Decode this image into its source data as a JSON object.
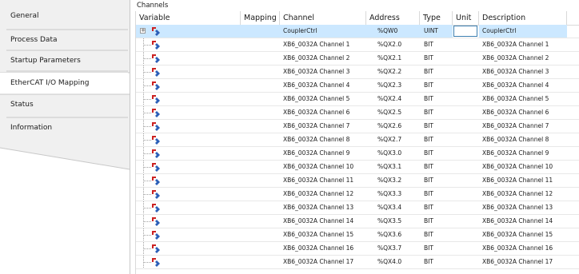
{
  "tabs": [
    {
      "label": "General",
      "active": false
    },
    {
      "label": "Process Data",
      "active": false
    },
    {
      "label": "Startup Parameters",
      "active": false
    },
    {
      "label": "EtherCAT I/O Mapping",
      "active": true
    },
    {
      "label": "Status",
      "active": false
    },
    {
      "label": "Information",
      "active": false
    }
  ],
  "panel": {
    "title": "Channels",
    "columns": [
      "Variable",
      "Mapping",
      "Channel",
      "Address",
      "Type",
      "Unit",
      "Description"
    ],
    "rows": [
      {
        "channel": "CouplerCtrl",
        "address": "%QW0",
        "type": "UINT",
        "description": "CouplerCtrl",
        "selected": true,
        "expandable": true
      },
      {
        "channel": "XB6_0032A Channel 1",
        "address": "%QX2.0",
        "type": "BIT",
        "description": "XB6_0032A Channel 1"
      },
      {
        "channel": "XB6_0032A Channel 2",
        "address": "%QX2.1",
        "type": "BIT",
        "description": "XB6_0032A Channel 2"
      },
      {
        "channel": "XB6_0032A Channel 3",
        "address": "%QX2.2",
        "type": "BIT",
        "description": "XB6_0032A Channel 3"
      },
      {
        "channel": "XB6_0032A Channel 4",
        "address": "%QX2.3",
        "type": "BIT",
        "description": "XB6_0032A Channel 4"
      },
      {
        "channel": "XB6_0032A Channel 5",
        "address": "%QX2.4",
        "type": "BIT",
        "description": "XB6_0032A Channel 5"
      },
      {
        "channel": "XB6_0032A Channel 6",
        "address": "%QX2.5",
        "type": "BIT",
        "description": "XB6_0032A Channel 6"
      },
      {
        "channel": "XB6_0032A Channel 7",
        "address": "%QX2.6",
        "type": "BIT",
        "description": "XB6_0032A Channel 7"
      },
      {
        "channel": "XB6_0032A Channel 8",
        "address": "%QX2.7",
        "type": "BIT",
        "description": "XB6_0032A Channel 8"
      },
      {
        "channel": "XB6_0032A Channel 9",
        "address": "%QX3.0",
        "type": "BIT",
        "description": "XB6_0032A Channel 9"
      },
      {
        "channel": "XB6_0032A Channel 10",
        "address": "%QX3.1",
        "type": "BIT",
        "description": "XB6_0032A Channel 10"
      },
      {
        "channel": "XB6_0032A Channel 11",
        "address": "%QX3.2",
        "type": "BIT",
        "description": "XB6_0032A Channel 11"
      },
      {
        "channel": "XB6_0032A Channel 12",
        "address": "%QX3.3",
        "type": "BIT",
        "description": "XB6_0032A Channel 12"
      },
      {
        "channel": "XB6_0032A Channel 13",
        "address": "%QX3.4",
        "type": "BIT",
        "description": "XB6_0032A Channel 13"
      },
      {
        "channel": "XB6_0032A Channel 14",
        "address": "%QX3.5",
        "type": "BIT",
        "description": "XB6_0032A Channel 14"
      },
      {
        "channel": "XB6_0032A Channel 15",
        "address": "%QX3.6",
        "type": "BIT",
        "description": "XB6_0032A Channel 15"
      },
      {
        "channel": "XB6_0032A Channel 16",
        "address": "%QX3.7",
        "type": "BIT",
        "description": "XB6_0032A Channel 16"
      },
      {
        "channel": "XB6_0032A Channel 17",
        "address": "%QX4.0",
        "type": "BIT",
        "description": "XB6_0032A Channel 17"
      }
    ]
  },
  "icons": {
    "variable": "output-variable-icon",
    "expander": "expand-plus-icon"
  },
  "colors": {
    "selection": "#cce8ff",
    "tab_bg": "#f0f0f0",
    "border": "#c8c8c8"
  }
}
